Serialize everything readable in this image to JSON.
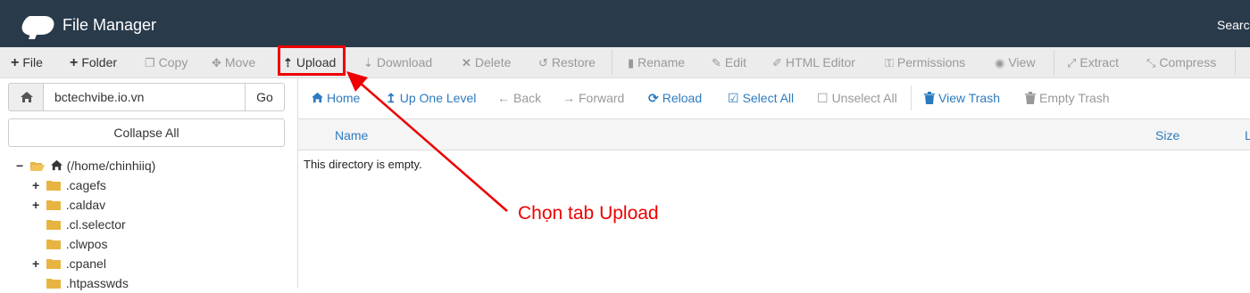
{
  "header": {
    "app_title": "File Manager",
    "search_label": "Searc",
    "logo_icon": "cpanel-logo"
  },
  "toolbar": {
    "items": [
      {
        "label": "File",
        "icon": "plus-icon"
      },
      {
        "label": "Folder",
        "icon": "plus-icon"
      },
      {
        "label": "Copy",
        "icon": "copy-icon"
      },
      {
        "label": "Move",
        "icon": "move-icon"
      },
      {
        "label": "Upload",
        "icon": "upload-icon"
      },
      {
        "label": "Download",
        "icon": "download-icon"
      },
      {
        "label": "Delete",
        "icon": "times-icon"
      },
      {
        "label": "Restore",
        "icon": "undo-icon"
      },
      {
        "label": "Rename",
        "icon": "file-icon"
      },
      {
        "label": "Edit",
        "icon": "pencil-icon"
      },
      {
        "label": "HTML Editor",
        "icon": "edit-icon"
      },
      {
        "label": "Permissions",
        "icon": "key-icon"
      },
      {
        "label": "View",
        "icon": "eye-icon"
      },
      {
        "label": "Extract",
        "icon": "expand-icon"
      },
      {
        "label": "Compress",
        "icon": "compress-icon"
      }
    ]
  },
  "sidebar": {
    "path_value": "bctechvibe.io.vn",
    "go_label": "Go",
    "collapse_label": "Collapse All",
    "tree": [
      {
        "label": "(/home/chinhiiq)",
        "toggle": "−"
      },
      {
        "label": ".cagefs",
        "toggle": "+"
      },
      {
        "label": ".caldav",
        "toggle": "+"
      },
      {
        "label": ".cl.selector",
        "toggle": ""
      },
      {
        "label": ".clwpos",
        "toggle": ""
      },
      {
        "label": ".cpanel",
        "toggle": "+"
      },
      {
        "label": ".htpasswds",
        "toggle": ""
      }
    ]
  },
  "navbar": {
    "items": [
      {
        "label": "Home",
        "icon": "home-icon"
      },
      {
        "label": "Up One Level",
        "icon": "level-up-icon"
      },
      {
        "label": "Back",
        "icon": "arrow-left-icon"
      },
      {
        "label": "Forward",
        "icon": "arrow-right-icon"
      },
      {
        "label": "Reload",
        "icon": "refresh-icon"
      },
      {
        "label": "Select All",
        "icon": "checkbox-checked-icon"
      },
      {
        "label": "Unselect All",
        "icon": "checkbox-empty-icon"
      },
      {
        "label": "View Trash",
        "icon": "trash-icon"
      },
      {
        "label": "Empty Trash",
        "icon": "trash-icon"
      }
    ]
  },
  "file_table": {
    "columns": [
      "Name",
      "Size",
      "L"
    ],
    "empty_message": "This directory is empty."
  },
  "annotation": {
    "text": "Chọn tab Upload",
    "color": "#e00000"
  },
  "colors": {
    "header_bg": "#293a4a",
    "toolbar_bg": "#ececec",
    "link_blue": "#2d7bbf",
    "folder_yellow": "#e8b441"
  }
}
